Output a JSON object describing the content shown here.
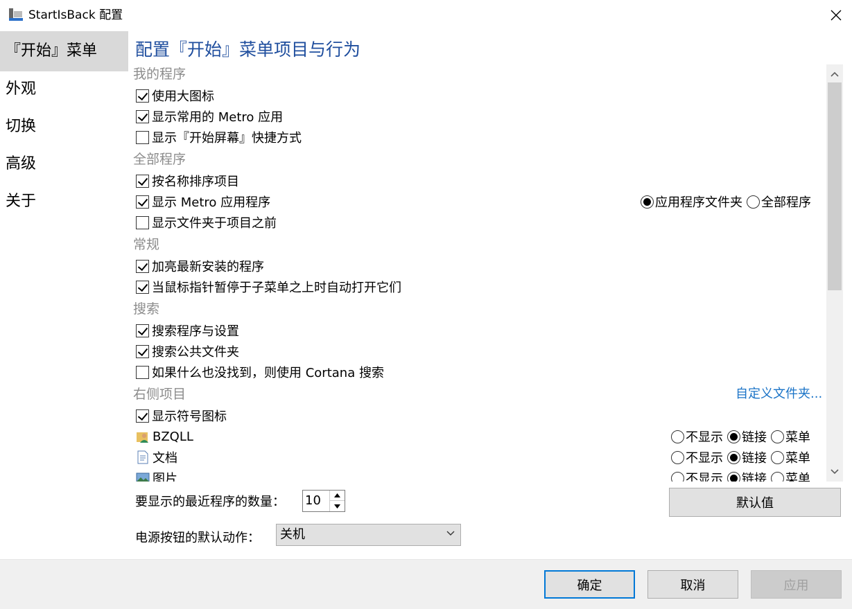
{
  "window": {
    "title": "StartIsBack 配置"
  },
  "sidebar": {
    "items": [
      {
        "label": "『开始』菜单",
        "selected": true
      },
      {
        "label": "外观",
        "selected": false
      },
      {
        "label": "切换",
        "selected": false
      },
      {
        "label": "高级",
        "selected": false
      },
      {
        "label": "关于",
        "selected": false
      }
    ]
  },
  "main": {
    "heading": "配置『开始』菜单项目与行为",
    "my_programs": {
      "title": "我的程序",
      "use_large_icons": {
        "label": "使用大图标",
        "checked": true
      },
      "show_metro": {
        "label": "显示常用的 Metro 应用",
        "checked": true
      },
      "show_start_shortcut": {
        "label": "显示『开始屏幕』快捷方式",
        "checked": false
      }
    },
    "all_programs": {
      "title": "全部程序",
      "sort_by_name": {
        "label": "按名称排序项目",
        "checked": true
      },
      "show_metro_apps": {
        "label": "显示 Metro 应用程序",
        "checked": true
      },
      "folders_first": {
        "label": "显示文件夹于项目之前",
        "checked": false
      },
      "radio_app_folder": {
        "label": "应用程序文件夹",
        "on": true
      },
      "radio_all": {
        "label": "全部程序",
        "on": false
      }
    },
    "general": {
      "title": "常规",
      "highlight_new": {
        "label": "加亮最新安装的程序",
        "checked": true
      },
      "hover_open": {
        "label": "当鼠标指针暂停于子菜单之上时自动打开它们",
        "checked": true
      }
    },
    "search": {
      "title": "搜索",
      "search_programs": {
        "label": "搜索程序与设置",
        "checked": true
      },
      "search_public": {
        "label": "搜索公共文件夹",
        "checked": true
      },
      "cortana": {
        "label": "如果什么也没找到，则使用 Cortana 搜索",
        "checked": false
      }
    },
    "right_items": {
      "title": "右侧项目",
      "customize_link": "自定义文件夹...",
      "show_symbol_icons": {
        "label": "显示符号图标",
        "checked": true
      },
      "opt_hide": "不显示",
      "opt_link": "链接",
      "opt_menu": "菜单",
      "items": [
        {
          "label": "BZQLL",
          "icon": "user-folder-icon",
          "selected": "link"
        },
        {
          "label": "文档",
          "icon": "document-icon",
          "selected": "link"
        },
        {
          "label": "图片",
          "icon": "pictures-icon",
          "selected": "link"
        }
      ]
    }
  },
  "bottom": {
    "recent_count_label": "要显示的最近程序的数量：",
    "recent_count_value": "10",
    "defaults_button": "默认值",
    "power_label": "电源按钮的默认动作：",
    "power_value": "关机"
  },
  "footer": {
    "ok": "确定",
    "cancel": "取消",
    "apply": "应用"
  },
  "colors": {
    "heading": "#1f4e9e",
    "link": "#1a73c7",
    "section": "#8c8c8c",
    "selected_nav": "#d9d9d9",
    "primary_border": "#0078d7"
  }
}
